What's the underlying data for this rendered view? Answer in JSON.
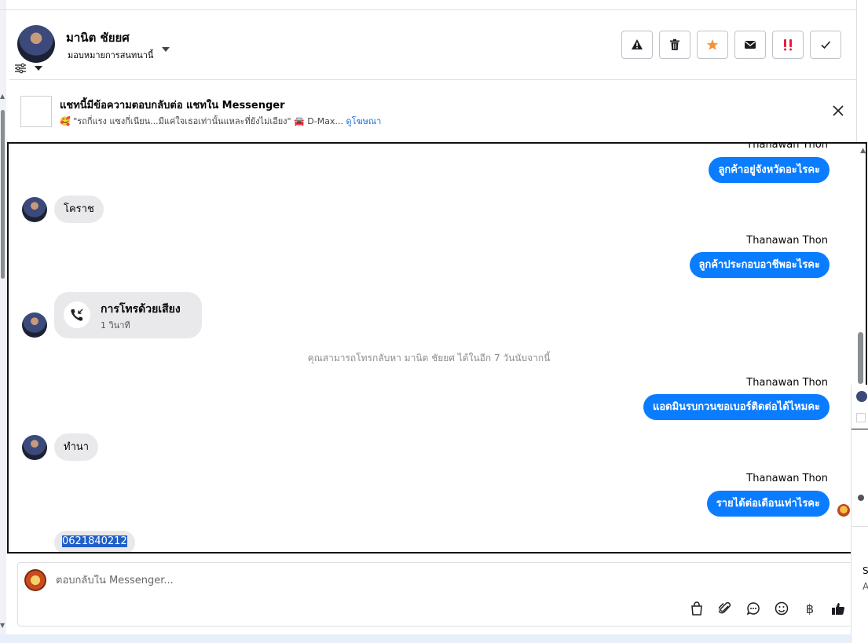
{
  "header": {
    "contact_name": "มานิต ชัยยศ",
    "assign_label": "มอบหมายการสนทนานี้",
    "actions": [
      "warning-icon",
      "trash-icon",
      "star-icon",
      "envelope-icon",
      "urgent-icon",
      "check-icon"
    ],
    "accent": "#f7923a",
    "urgent_color": "#e41e3f"
  },
  "ad_banner": {
    "title": "แชทนี้มีข้อความตอบกลับต่อ แชทใน Messenger",
    "subtitle": "🥰 \"รถกี่แรง แซงกี่เนียน...มีแค่ใจเธอเท่านั้นแหละที่ยังไม่เอียง\" 🚘 D-Max...",
    "link_label": "ดูโฆษณา"
  },
  "chat": {
    "messages": [
      {
        "dir": "out",
        "sender": "Thanawan Thon",
        "text": "ลูกค้าอยู่จังหวัดอะไรคะ"
      },
      {
        "dir": "in",
        "text": "โคราช"
      },
      {
        "dir": "out",
        "sender": "Thanawan Thon",
        "text": "ลูกค้าประกอบอาชีพอะไรคะ"
      },
      {
        "dir": "in",
        "type": "call",
        "title": "การโทรด้วยเสียง",
        "duration": "1 วินาที"
      },
      {
        "dir": "system",
        "text": "คุณสามารถโทรกลับหา มานิต ชัยยศ ได้ในอีก 7 วันนับจากนี้"
      },
      {
        "dir": "out",
        "sender": "Thanawan Thon",
        "text": "แอดมินรบกวนขอเบอร์ติดต่อได้ไหมคะ"
      },
      {
        "dir": "in",
        "text": "ทำนา"
      },
      {
        "dir": "out",
        "sender": "Thanawan Thon",
        "text": "รายได้ต่อเดือนเท่าไรคะ"
      },
      {
        "dir": "in",
        "text": "0621840212"
      }
    ],
    "outgoing_color": "#0a7cff"
  },
  "composer": {
    "placeholder": "ตอบกลับใน Messenger...",
    "tools": [
      "bag-icon",
      "paperclip-icon",
      "chat-bubble-icon",
      "smiley-icon",
      "baht-icon",
      "thumbs-up-icon"
    ],
    "baht_symbol": "฿"
  },
  "side_panel": {
    "text1": "S",
    "text2": "A"
  }
}
